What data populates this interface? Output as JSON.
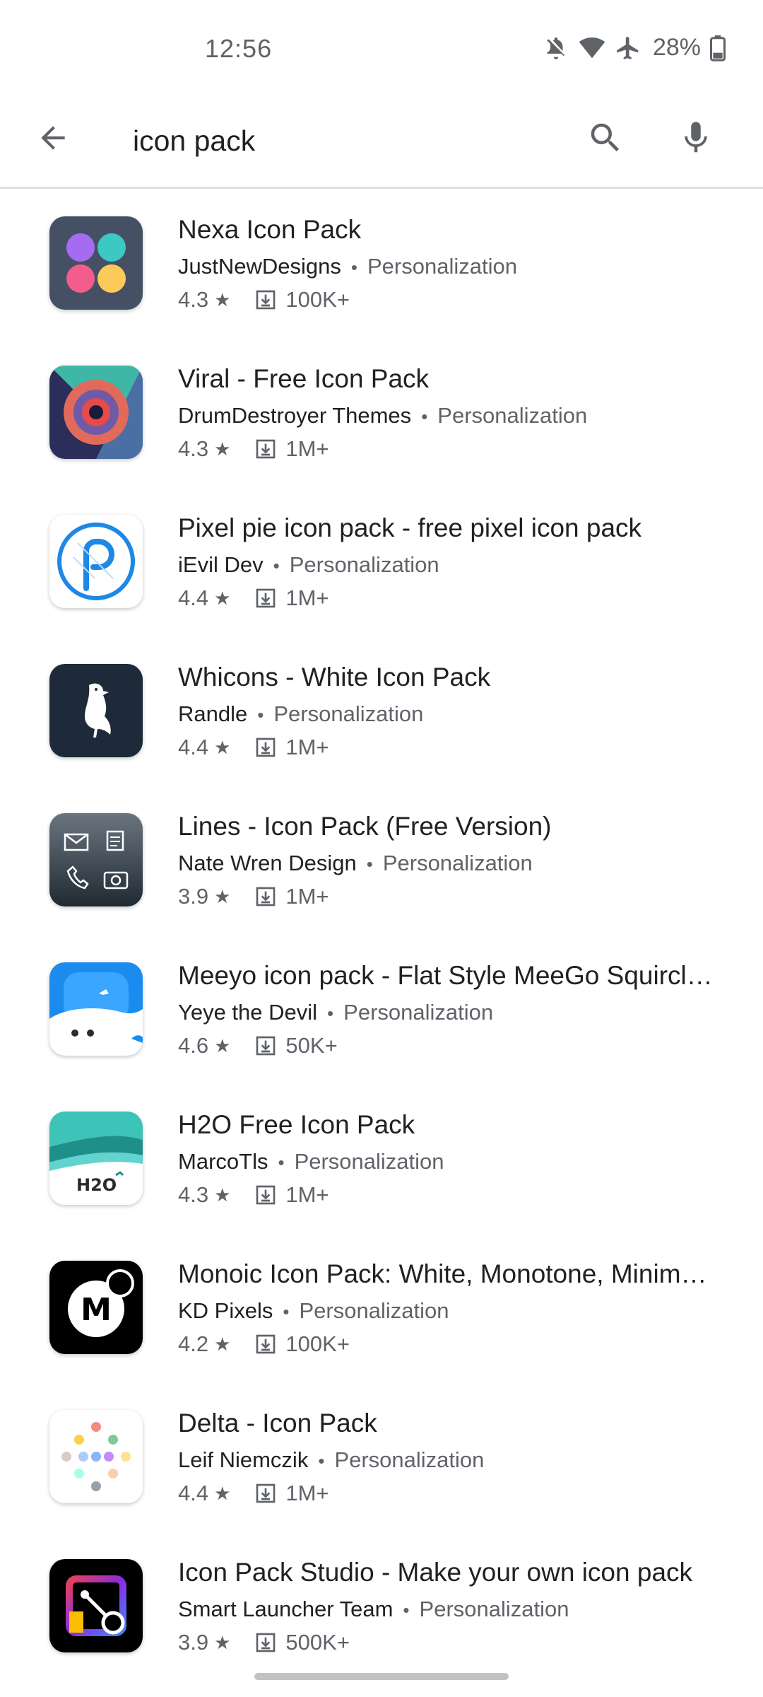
{
  "status_bar": {
    "time": "12:56",
    "battery": "28%",
    "icons": [
      "notifications-off-icon",
      "wifi-icon",
      "airplane-icon",
      "battery-icon"
    ]
  },
  "search": {
    "query": "icon pack",
    "icons": [
      "back-arrow-icon",
      "search-icon",
      "mic-icon"
    ]
  },
  "apps": [
    {
      "title": "Nexa Icon Pack",
      "developer": "JustNewDesigns",
      "category": "Personalization",
      "rating": "4.3",
      "downloads": "100K+"
    },
    {
      "title": "Viral - Free Icon Pack",
      "developer": "DrumDestroyer Themes",
      "category": "Personalization",
      "rating": "4.3",
      "downloads": "1M+"
    },
    {
      "title": "Pixel pie icon pack - free pixel icon pack",
      "developer": "iEvil Dev",
      "category": "Personalization",
      "rating": "4.4",
      "downloads": "1M+"
    },
    {
      "title": "Whicons - White Icon Pack",
      "developer": "Randle",
      "category": "Personalization",
      "rating": "4.4",
      "downloads": "1M+"
    },
    {
      "title": "Lines - Icon Pack (Free Version)",
      "developer": "Nate Wren Design",
      "category": "Personalization",
      "rating": "3.9",
      "downloads": "1M+"
    },
    {
      "title": "Meeyo icon pack - Flat Style MeeGo Squircle …",
      "developer": "Yeye the Devil",
      "category": "Personalization",
      "rating": "4.6",
      "downloads": "50K+"
    },
    {
      "title": "H2O Free Icon Pack",
      "developer": "MarcoTls",
      "category": "Personalization",
      "rating": "4.3",
      "downloads": "1M+",
      "icon_text": "H2O"
    },
    {
      "title": "Monoic Icon Pack: White, Monotone, Minimal…",
      "developer": "KD Pixels",
      "category": "Personalization",
      "rating": "4.2",
      "downloads": "100K+",
      "icon_text": "M"
    },
    {
      "title": "Delta - Icon Pack",
      "developer": "Leif Niemczik",
      "category": "Personalization",
      "rating": "4.4",
      "downloads": "1M+"
    },
    {
      "title": "Icon Pack Studio - Make your own icon pack",
      "developer": "Smart Launcher Team",
      "category": "Personalization",
      "rating": "3.9",
      "downloads": "500K+"
    }
  ],
  "rating_star": "★",
  "meta_separator": "•"
}
